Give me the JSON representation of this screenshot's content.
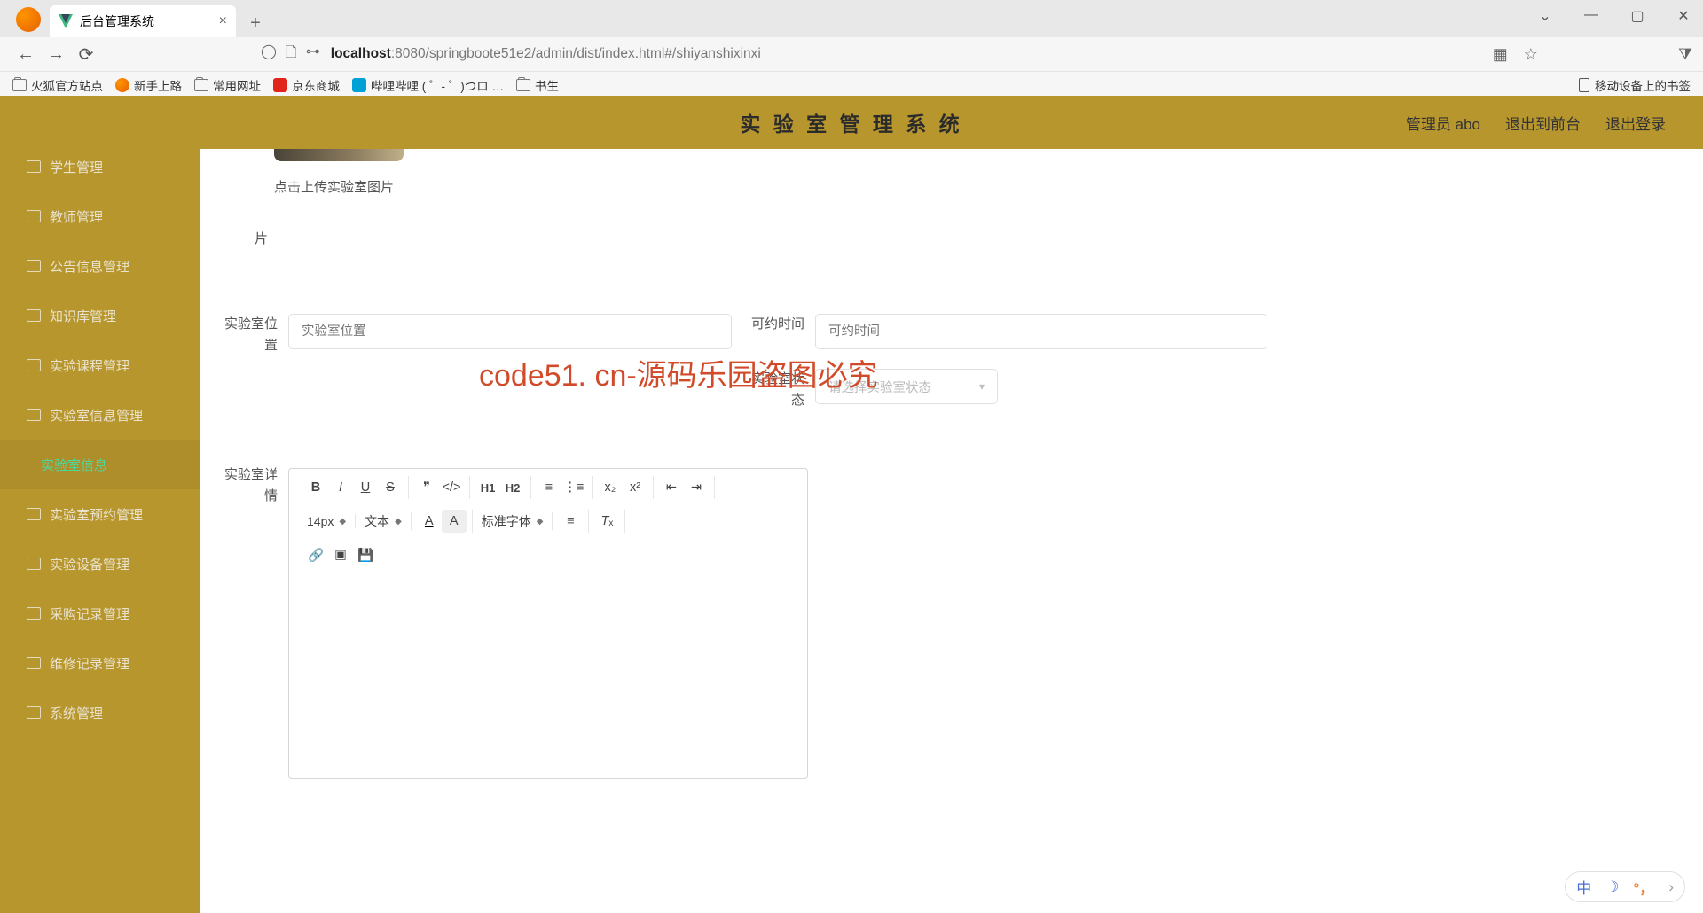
{
  "browser": {
    "tab_title": "后台管理系统",
    "url_host": "localhost",
    "url_path": ":8080/springboote51e2/admin/dist/index.html#/shiyanshixinxi",
    "bookmarks": [
      "火狐官方站点",
      "新手上路",
      "常用网址",
      "京东商城",
      "哔哩哔哩 (  ゜- ゜)つロ …",
      "书生"
    ],
    "mobile_bm": "移动设备上的书签"
  },
  "header": {
    "app_title": "实 验 室 管 理 系 统",
    "user_label": "管理员 abo",
    "to_front": "退出到前台",
    "logout": "退出登录"
  },
  "sidebar": {
    "items": [
      {
        "label": "学生管理"
      },
      {
        "label": "教师管理"
      },
      {
        "label": "公告信息管理"
      },
      {
        "label": "知识库管理"
      },
      {
        "label": "实验课程管理"
      },
      {
        "label": "实验室信息管理"
      },
      {
        "label": "实验室信息",
        "active": true
      },
      {
        "label": "实验室预约管理"
      },
      {
        "label": "实验设备管理"
      },
      {
        "label": "采购记录管理"
      },
      {
        "label": "维修记录管理"
      },
      {
        "label": "系统管理"
      }
    ]
  },
  "form": {
    "upload_hint": "点击上传实验室图片",
    "upload_suffix": "片",
    "lab_location_label": "实验室位置",
    "lab_location_placeholder": "实验室位置",
    "time_label": "可约时间",
    "time_placeholder": "可约时间",
    "status_label": "实验室状态",
    "status_placeholder": "请选择实验室状态",
    "detail_label": "实验室详情"
  },
  "editor": {
    "font_size": "14px",
    "style_sel": "文本",
    "font_family": "标准字体"
  },
  "watermark": {
    "big": "code51. cn-源码乐园盗图必究"
  },
  "ime": {
    "lang": "中"
  }
}
